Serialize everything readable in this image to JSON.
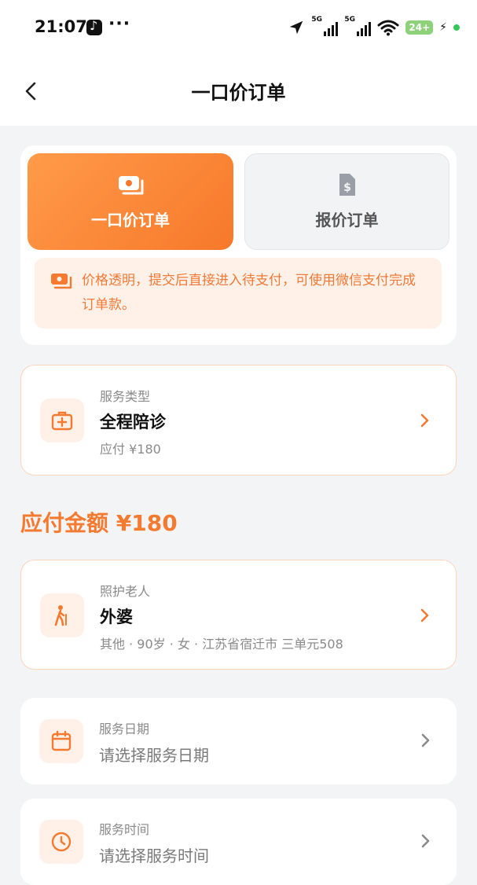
{
  "status_bar": {
    "time": "21:07",
    "notification_icon": "tiktok-icon",
    "more": "···",
    "signal_1": "5G",
    "signal_2": "5G",
    "battery": "24+"
  },
  "header": {
    "title": "一口价订单",
    "back_icon": "chevron-left-icon"
  },
  "order_type": {
    "tabs": [
      {
        "label": "一口价订单",
        "icon": "cash-icon",
        "active": true
      },
      {
        "label": "报价订单",
        "icon": "document-dollar-icon",
        "active": false
      }
    ],
    "notice": "价格透明，提交后直接进入待支付，可使用微信支付完成订单款。"
  },
  "service": {
    "label": "服务类型",
    "value": "全程陪诊",
    "price_note": "应付 ¥180",
    "icon": "medical-kit-icon"
  },
  "amount_due": "应付金额 ¥180",
  "patient": {
    "label": "照护老人",
    "name": "外婆",
    "details": "其他 · 90岁 · 女 · 江苏省宿迁市 三单元508",
    "icon": "elderly-person-icon"
  },
  "service_date": {
    "label": "服务日期",
    "placeholder": "请选择服务日期",
    "icon": "calendar-icon"
  },
  "service_time": {
    "label": "服务时间",
    "placeholder": "请选择服务时间",
    "icon": "clock-icon"
  },
  "colors": {
    "accent": "#f47a30",
    "accent_light": "#fff1e8",
    "background": "#f3f4f6"
  }
}
